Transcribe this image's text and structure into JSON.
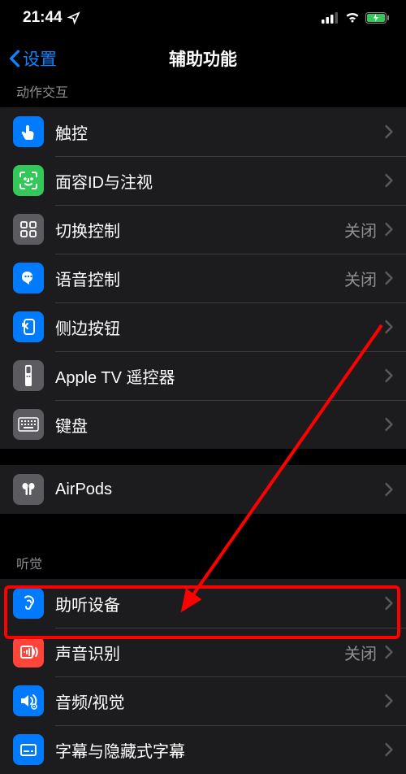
{
  "status": {
    "time": "21:44",
    "location_glyph": "↗"
  },
  "nav": {
    "back_label": "设置",
    "title": "辅助功能"
  },
  "section_physical": "动作交互",
  "section_hearing": "听觉",
  "status_off": "关闭",
  "rows": {
    "touch": "触控",
    "faceid": "面容ID与注视",
    "switch_control": "切换控制",
    "voice_control": "语音控制",
    "side_button": "侧边按钮",
    "apple_tv": "Apple TV 遥控器",
    "keyboard": "键盘",
    "airpods": "AirPods",
    "hearing_devices": "助听设备",
    "sound_recognition": "声音识别",
    "audio_visual": "音频/视觉",
    "subtitles": "字幕与隐藏式字幕"
  }
}
